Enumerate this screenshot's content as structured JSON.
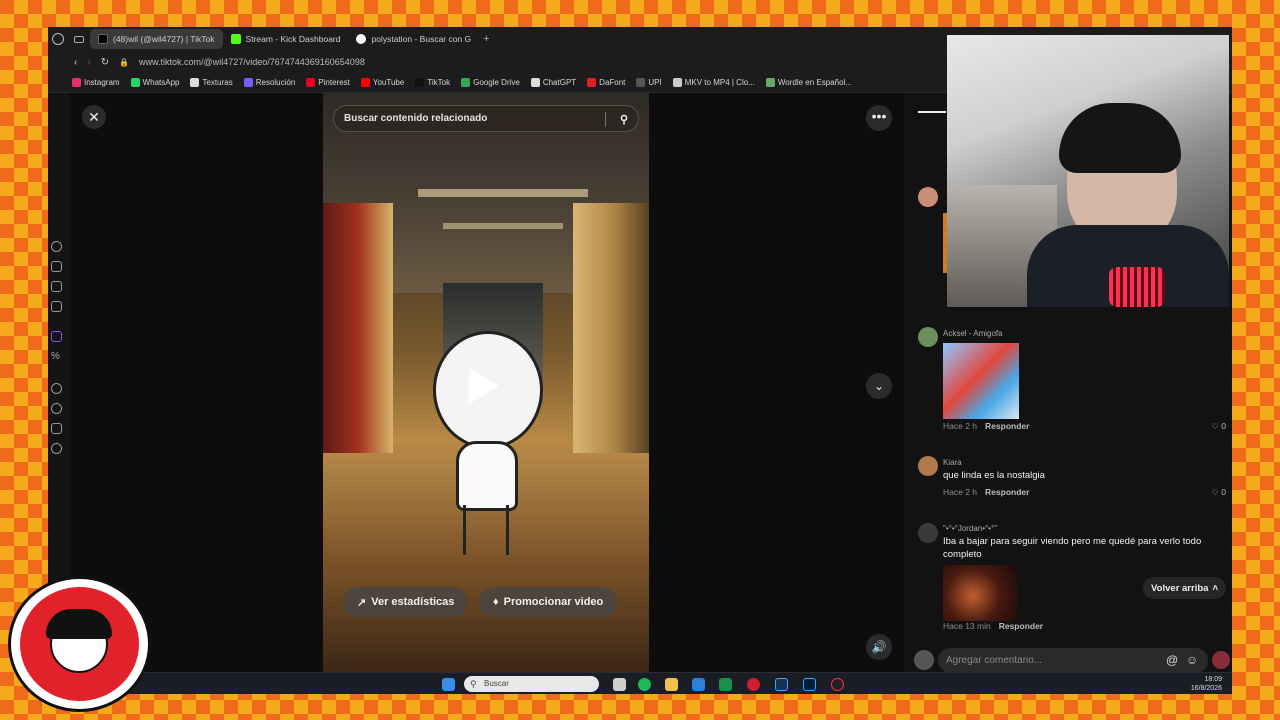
{
  "browser": {
    "tabs": [
      {
        "label": "(48)wil (@wil4727) | TikTok",
        "active": true,
        "color": "#111111"
      },
      {
        "label": "Stream - Kick Dashboard",
        "active": false,
        "color": "#53fc18"
      },
      {
        "label": "polystation - Buscar con G",
        "active": false,
        "color": "#4285f4"
      }
    ],
    "new_tab_glyph": "+",
    "url": "www.tiktok.com/@wil4727/video/7674744369160654098",
    "bookmarks": [
      {
        "label": "Instagram",
        "color": "#e1306c"
      },
      {
        "label": "WhatsApp",
        "color": "#25d366"
      },
      {
        "label": "Texturas",
        "color": "#dddddd"
      },
      {
        "label": "Resolución",
        "color": "#7a5cff"
      },
      {
        "label": "Pinterest",
        "color": "#e60023"
      },
      {
        "label": "YouTube",
        "color": "#ff0000"
      },
      {
        "label": "TikTok",
        "color": "#111111"
      },
      {
        "label": "Google Drive",
        "color": "#34a853"
      },
      {
        "label": "ChatGPT",
        "color": "#dddddd"
      },
      {
        "label": "DaFont",
        "color": "#e02020"
      },
      {
        "label": "UPI",
        "color": "#555555"
      },
      {
        "label": "MKV to MP4 | Clo...",
        "color": "#cccccc"
      },
      {
        "label": "Wordle en Español...",
        "color": "#6aaa64"
      }
    ]
  },
  "video": {
    "search_placeholder": "Buscar contenido relacionado",
    "stats_button": "Ver estadísticas",
    "promote_button": "Promocionar video"
  },
  "comments": {
    "items": [
      {
        "name": "Acksel - Amigofa",
        "text": "",
        "time": "Hace 2 h",
        "reply": "Responder",
        "likes": "0",
        "avatar_color": "#6a8f5a"
      },
      {
        "name": "Kiara",
        "text": "que linda es la nostalgia",
        "time": "Hace 2 h",
        "reply": "Responder",
        "likes": "0",
        "avatar_color": "#b07a4a"
      },
      {
        "name": "\"•°•°Jordan•°•°\"",
        "text": "Iba a bajar para seguir viendo pero me quedé para verlo todo completo",
        "time": "Hace 13 min",
        "reply": "Responder",
        "likes": "0",
        "avatar_color": "#3a3a3a"
      }
    ],
    "back_to_top": "Volver arriba",
    "input_placeholder": "Agregar comentario..."
  },
  "taskbar": {
    "search_placeholder": "Buscar",
    "time": "18:09",
    "date": "16/8/2026"
  }
}
